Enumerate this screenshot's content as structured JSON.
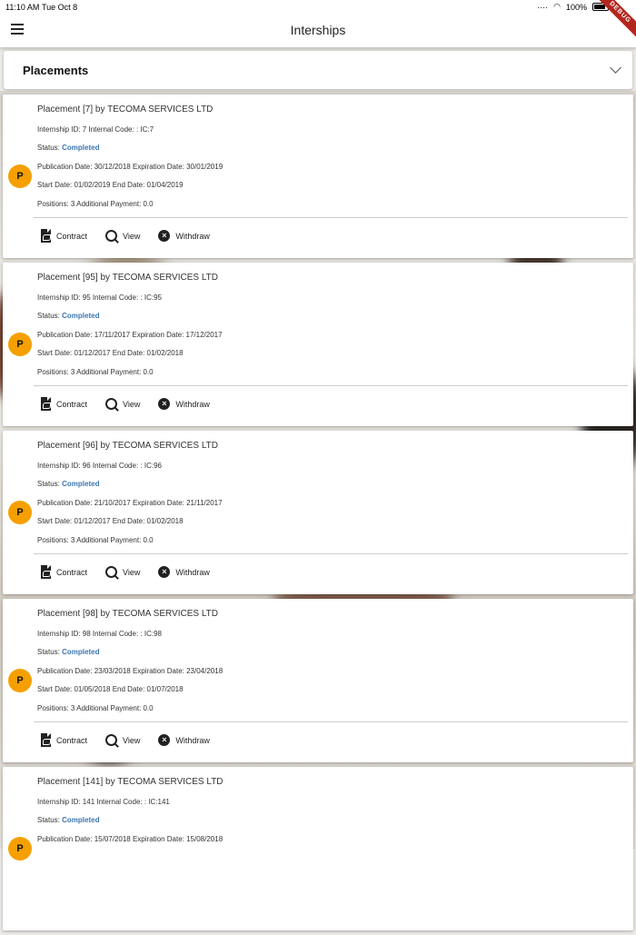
{
  "status_bar": {
    "time": "11:10 AM",
    "date": "Tue Oct 8",
    "battery": "100%",
    "ribbon": "DEBUG"
  },
  "app_bar": {
    "title": "Interships"
  },
  "section": {
    "label": "Placements"
  },
  "labels": {
    "contract": "Contract",
    "view": "View",
    "withdraw": "Withdraw",
    "status": "Status:"
  },
  "placements": [
    {
      "avatar": "P",
      "title": "Placement [7] by TECOMA SERVICES LTD",
      "ids": "Internship ID: 7 Internal Code: : IC:7",
      "status": "Completed",
      "pub": "Publication Date: 30/12/2018 Expiration Date: 30/01/2019",
      "dates": "Start Date: 01/02/2019 End Date: 01/04/2019",
      "positions": "Positions: 3 Additional Payment: 0.0"
    },
    {
      "avatar": "P",
      "title": "Placement [95] by TECOMA SERVICES LTD",
      "ids": "Internship ID: 95 Internal Code: : IC:95",
      "status": "Completed",
      "pub": "Publication Date: 17/11/2017 Expiration Date: 17/12/2017",
      "dates": "Start Date: 01/12/2017 End Date: 01/02/2018",
      "positions": "Positions: 3 Additional Payment: 0.0"
    },
    {
      "avatar": "P",
      "title": "Placement [96] by TECOMA SERVICES LTD",
      "ids": "Internship ID: 96 Internal Code: : IC:96",
      "status": "Completed",
      "pub": "Publication Date: 21/10/2017 Expiration Date: 21/11/2017",
      "dates": "Start Date: 01/12/2017 End Date: 01/02/2018",
      "positions": "Positions: 3 Additional Payment: 0.0"
    },
    {
      "avatar": "P",
      "title": "Placement [98] by TECOMA SERVICES LTD",
      "ids": "Internship ID: 98 Internal Code: : IC:98",
      "status": "Completed",
      "pub": "Publication Date: 23/03/2018 Expiration Date: 23/04/2018",
      "dates": "Start Date: 01/05/2018 End Date: 01/07/2018",
      "positions": "Positions: 3 Additional Payment: 0.0"
    },
    {
      "avatar": "P",
      "title": "Placement [141] by TECOMA SERVICES LTD",
      "ids": "Internship ID: 141 Internal Code: : IC:141",
      "status": "Completed",
      "pub": "Publication Date: 15/07/2018 Expiration Date: 15/08/2018",
      "dates": "",
      "positions": ""
    }
  ],
  "colors": {
    "accent": "#f5a000",
    "status": "#3c78b4"
  }
}
